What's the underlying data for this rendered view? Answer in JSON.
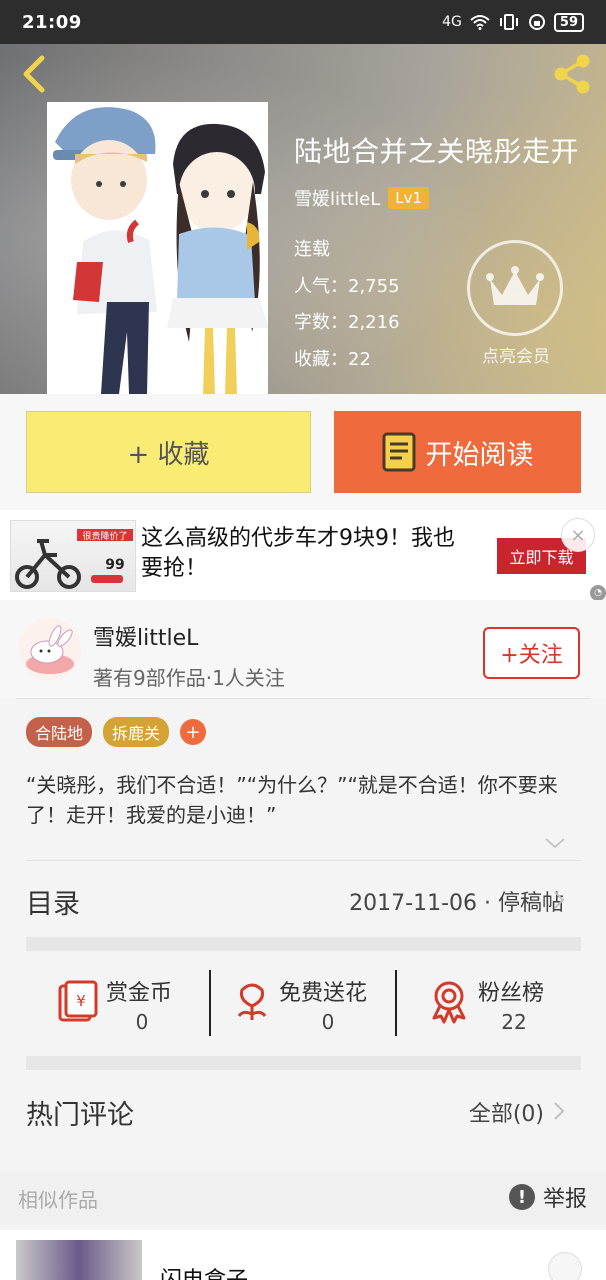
{
  "status_bar": {
    "time": "21:09",
    "network": "4G",
    "battery": "59"
  },
  "book": {
    "title": "陆地合并之关晓彤走开",
    "author": "雪媛littleL",
    "level": "Lv1",
    "status": "连载",
    "popularity": "人气：2,755",
    "word_count": "字数：2,216",
    "favorites": "收藏：22",
    "vip_label": "点亮会员"
  },
  "actions": {
    "favorite_label": "+ 收藏",
    "read_label": "开始阅读"
  },
  "ad": {
    "text": "这么高级的代步车才9块9！我也要抢！",
    "button": "立即下载",
    "thumb_banner": "很贵降价了",
    "thumb_price": "99",
    "close": "×"
  },
  "author_card": {
    "name": "雪媛littleL",
    "meta": "著有9部作品·1人关注",
    "follow": "+关注"
  },
  "tags": [
    "合陆地",
    "拆鹿关"
  ],
  "tag_add": "+",
  "description": "“关晓彤，我们不合适！”“为什么？”“就是不合适！你不要来了！走开！我爱的是小迪！”",
  "toc": {
    "title": "目录",
    "latest": "2017-11-06 · 停稿帖"
  },
  "stats": [
    {
      "label": "赏金币",
      "value": "0"
    },
    {
      "label": "免费送花",
      "value": "0"
    },
    {
      "label": "粉丝榜",
      "value": "22"
    }
  ],
  "comments": {
    "title": "热门评论",
    "all": "全部(0)"
  },
  "similar": {
    "label": "相似作品",
    "report": "举报",
    "report_icon": "!"
  },
  "bottom": {
    "title": "闪电盒子"
  },
  "colors": {
    "accent": "#ef6a3d",
    "favorite_bg": "#f8ec75",
    "follow_red": "#d9352a",
    "level_badge": "#f2b233"
  }
}
